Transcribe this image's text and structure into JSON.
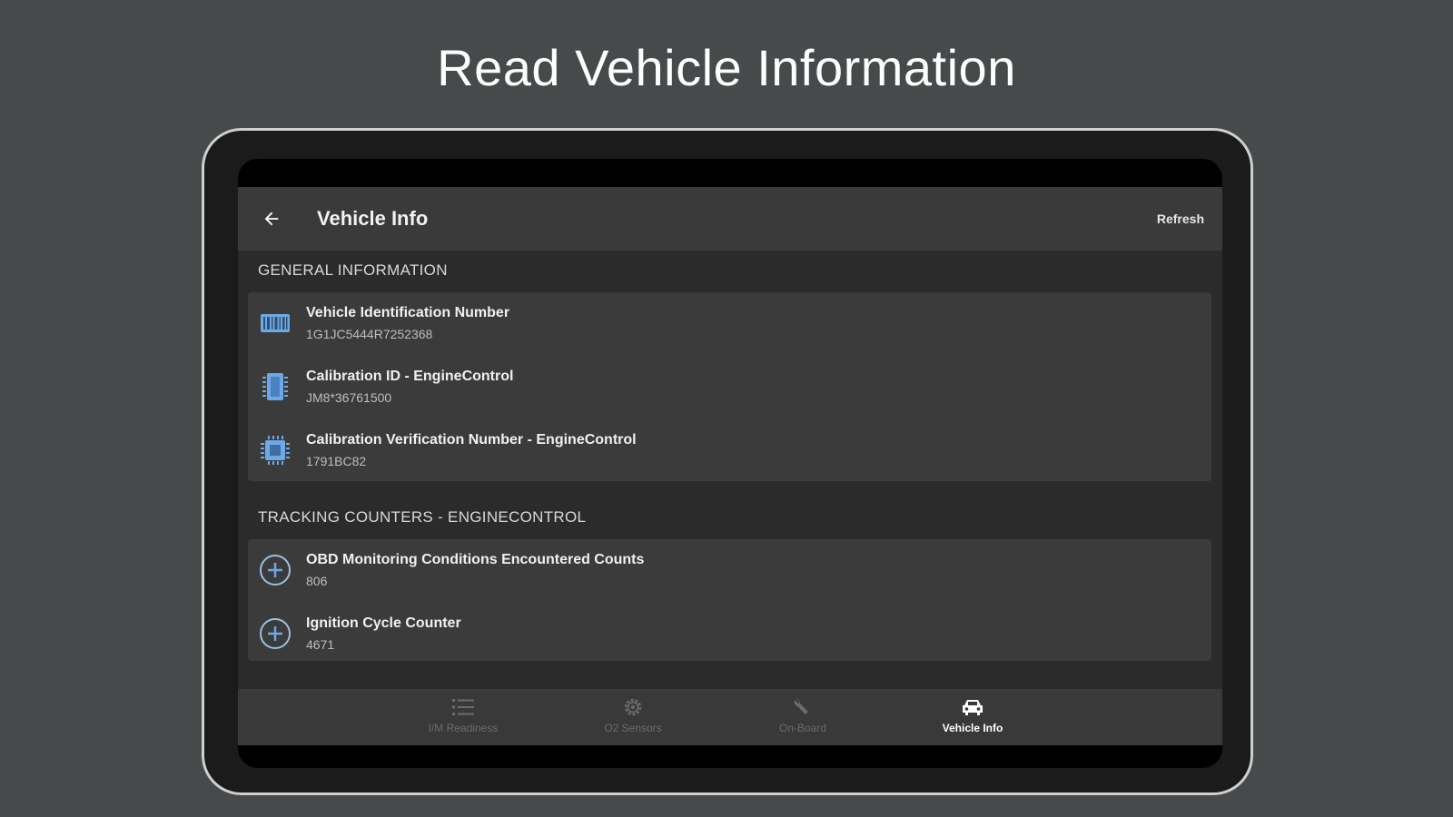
{
  "headline": "Read Vehicle Information",
  "appbar": {
    "title": "Vehicle Info",
    "refresh_label": "Refresh"
  },
  "sections": {
    "general": {
      "title": "GENERAL INFORMATION",
      "items": [
        {
          "label": "Vehicle Identification Number",
          "value": "1G1JC5444R7252368",
          "icon": "barcode-icon"
        },
        {
          "label": "Calibration ID - EngineControl",
          "value": "JM8*36761500",
          "icon": "memory-chip-icon"
        },
        {
          "label": "Calibration Verification Number - EngineControl",
          "value": "1791BC82",
          "icon": "processor-icon"
        }
      ]
    },
    "tracking": {
      "title": "TRACKING COUNTERS - ENGINECONTROL",
      "items": [
        {
          "label": "OBD Monitoring Conditions Encountered Counts",
          "value": "806",
          "icon": "plus-circle-icon"
        },
        {
          "label": "Ignition Cycle Counter",
          "value": "4671",
          "icon": "plus-circle-icon"
        }
      ]
    }
  },
  "bottom_nav": {
    "items": [
      {
        "label": "I/M Readiness",
        "icon": "list-icon",
        "active": false
      },
      {
        "label": "O2 Sensors",
        "icon": "gear-icon",
        "active": false
      },
      {
        "label": "On-Board",
        "icon": "wrench-icon",
        "active": false
      },
      {
        "label": "Vehicle Info",
        "icon": "car-icon",
        "active": true
      }
    ]
  },
  "colors": {
    "background": "#464a4b",
    "appbar": "#3a3a3a",
    "card": "#3b3b3b",
    "icon_blue": "#6ea8e6",
    "nav_inactive": "#6b6b6b",
    "nav_active": "#ffffff"
  }
}
